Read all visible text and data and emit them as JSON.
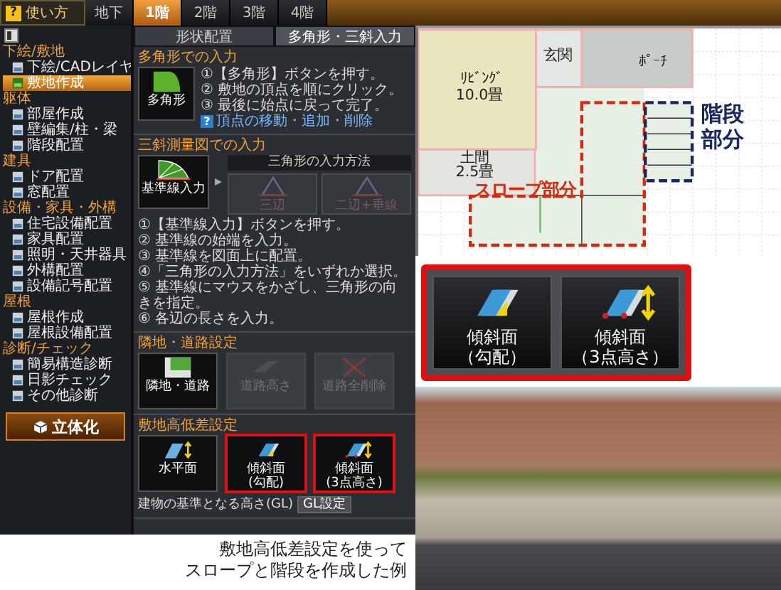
{
  "help_button": {
    "icon": "?",
    "label": "使い方"
  },
  "floor_tabs": [
    {
      "label": "地下",
      "selected": false
    },
    {
      "label": "1階",
      "selected": true
    },
    {
      "label": "2階",
      "selected": false
    },
    {
      "label": "3階",
      "selected": false
    },
    {
      "label": "4階",
      "selected": false
    }
  ],
  "sidebar": {
    "groups": [
      {
        "title": "下絵/敷地",
        "items": [
          {
            "label": "下絵/CADレイヤ",
            "selected": false
          },
          {
            "label": "敷地作成",
            "selected": true
          }
        ]
      },
      {
        "title": "躯体",
        "items": [
          {
            "label": "部屋作成",
            "selected": false
          },
          {
            "label": "壁編集/柱・梁",
            "selected": false
          },
          {
            "label": "階段配置",
            "selected": false
          }
        ]
      },
      {
        "title": "建具",
        "items": [
          {
            "label": "ドア配置",
            "selected": false
          },
          {
            "label": "窓配置",
            "selected": false
          }
        ]
      },
      {
        "title": "設備・家具・外構",
        "items": [
          {
            "label": "住宅設備配置",
            "selected": false
          },
          {
            "label": "家具配置",
            "selected": false
          },
          {
            "label": "照明・天井器具",
            "selected": false
          },
          {
            "label": "外構配置",
            "selected": false
          },
          {
            "label": "設備記号配置",
            "selected": false
          }
        ]
      },
      {
        "title": "屋根",
        "items": [
          {
            "label": "屋根作成",
            "selected": false
          },
          {
            "label": "屋根設備配置",
            "selected": false
          }
        ]
      },
      {
        "title": "診断/チェック",
        "items": [
          {
            "label": "簡易構造診断",
            "selected": false
          },
          {
            "label": "日影チェック",
            "selected": false
          },
          {
            "label": "その他診断",
            "selected": false
          }
        ]
      }
    ],
    "build_button": "立体化"
  },
  "panel": {
    "tabs": [
      {
        "label": "形状配置",
        "selected": false
      },
      {
        "label": "多角形・三斜入力",
        "selected": true
      }
    ],
    "sections": [
      {
        "kind": "polygon",
        "title": "多角形での入力",
        "button": "多角形",
        "steps": [
          "①【多角形】ボタンを押す。",
          "② 敷地の頂点を順にクリック。",
          "③ 最後に始点に戻って完了。"
        ],
        "link_icon": "?",
        "link": "頂点の移動・追加・削除"
      },
      {
        "kind": "survey",
        "title": "三斜測量図での入力",
        "button": "基準線入力",
        "method_label": "三角形の入力方法",
        "methods": [
          {
            "label": "三辺",
            "disabled": true
          },
          {
            "label": "二辺+垂線",
            "disabled": true
          }
        ],
        "steps": [
          "①【基準線入力】ボタンを押す。",
          "② 基準線の始端を入力。",
          "③ 基準線を図面上に配置。",
          "④「三角形の入力方法」をいずれか選択。",
          "⑤ 基準線にマウスをかざし、三角形の向きを指定。",
          "⑥ 各辺の長さを入力。"
        ]
      },
      {
        "kind": "buttons",
        "title": "隣地・道路設定",
        "buttons": [
          {
            "kind": "neighbor",
            "label": "隣地・道路",
            "disabled": false,
            "highlighted": false
          },
          {
            "kind": "road-height",
            "label": "道路高さ",
            "disabled": true,
            "highlighted": false
          },
          {
            "kind": "road-delete",
            "label": "道路全削除",
            "disabled": true,
            "highlighted": false
          }
        ]
      },
      {
        "kind": "buttons",
        "title": "敷地高低差設定",
        "buttons": [
          {
            "kind": "flat",
            "label": "水平面",
            "disabled": false,
            "highlighted": false
          },
          {
            "kind": "slope",
            "label": "傾斜面",
            "sub": "(勾配)",
            "disabled": false,
            "highlighted": true
          },
          {
            "kind": "slope3",
            "label": "傾斜面",
            "sub": "(3点高さ)",
            "disabled": false,
            "highlighted": true
          }
        ],
        "note": "建物の基準となる高さ(GL)",
        "note_button": "GL設定"
      }
    ]
  },
  "floor_plan": {
    "rooms": [
      {
        "kind": "living",
        "name": "ﾘﾋﾞﾝｸﾞ",
        "area": "10.0畳"
      },
      {
        "kind": "entrance",
        "name": "玄関"
      },
      {
        "kind": "porch",
        "name": "ﾎﾟｰﾁ"
      },
      {
        "kind": "earth-floor",
        "name": "土間",
        "area": "2.5畳"
      }
    ],
    "annotations": [
      {
        "kind": "slope",
        "label": "スロープ部分"
      },
      {
        "kind": "stairs",
        "label": "階段部分"
      }
    ]
  },
  "callout": {
    "buttons": [
      {
        "kind": "slope",
        "label": "傾斜面",
        "sub": "（勾配）"
      },
      {
        "kind": "slope3",
        "label": "傾斜面",
        "sub": "（3点高さ）"
      }
    ]
  },
  "caption": [
    "敷地高低差設定を使って",
    "スロープと階段を作成した例"
  ]
}
